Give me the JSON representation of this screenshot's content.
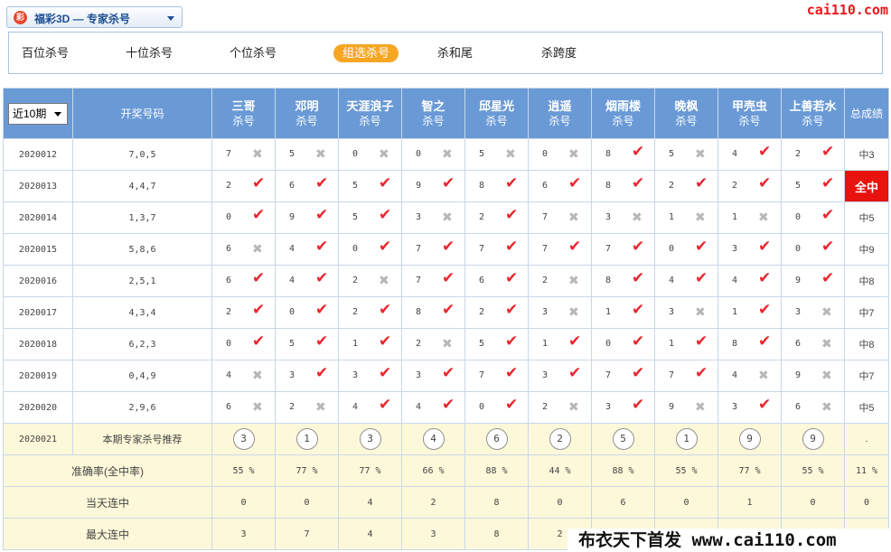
{
  "header": {
    "lottery_logo": "彩",
    "lottery_title": "福彩3D — 专家杀号",
    "brand": "cai110.com"
  },
  "tabs": [
    "百位杀号",
    "十位杀号",
    "个位杀号",
    "组选杀号",
    "杀和尾",
    "杀跨度"
  ],
  "active_tab": 3,
  "table": {
    "period_select": "近10期",
    "draw_col": "开奖号码",
    "total_col": "总成绩",
    "experts": [
      {
        "name": "三哥",
        "sub": "杀号"
      },
      {
        "name": "邓明",
        "sub": "杀号"
      },
      {
        "name": "天涯浪子",
        "sub": "杀号"
      },
      {
        "name": "智之",
        "sub": "杀号"
      },
      {
        "name": "邱星光",
        "sub": "杀号"
      },
      {
        "name": "逍遥",
        "sub": "杀号"
      },
      {
        "name": "烟雨楼",
        "sub": "杀号"
      },
      {
        "name": "晚枫",
        "sub": "杀号"
      },
      {
        "name": "甲壳虫",
        "sub": "杀号"
      },
      {
        "name": "上善若水",
        "sub": "杀号"
      }
    ],
    "rows": [
      {
        "period": "2020012",
        "draw": "7,0,5",
        "picks": [
          7,
          5,
          0,
          0,
          5,
          0,
          8,
          5,
          4,
          2
        ],
        "hits": [
          0,
          0,
          0,
          0,
          0,
          0,
          1,
          0,
          1,
          1
        ],
        "total": "中3"
      },
      {
        "period": "2020013",
        "draw": "4,4,7",
        "picks": [
          2,
          6,
          5,
          9,
          8,
          6,
          8,
          2,
          2,
          5
        ],
        "hits": [
          1,
          1,
          1,
          1,
          1,
          1,
          1,
          1,
          1,
          1
        ],
        "total": "全中",
        "full": true
      },
      {
        "period": "2020014",
        "draw": "1,3,7",
        "picks": [
          0,
          9,
          5,
          3,
          2,
          7,
          3,
          1,
          1,
          0
        ],
        "hits": [
          1,
          1,
          1,
          0,
          1,
          0,
          0,
          0,
          0,
          1
        ],
        "total": "中5"
      },
      {
        "period": "2020015",
        "draw": "5,8,6",
        "picks": [
          6,
          4,
          0,
          7,
          7,
          7,
          7,
          0,
          3,
          0
        ],
        "hits": [
          0,
          1,
          1,
          1,
          1,
          1,
          1,
          1,
          1,
          1
        ],
        "total": "中9"
      },
      {
        "period": "2020016",
        "draw": "2,5,1",
        "picks": [
          6,
          4,
          2,
          7,
          6,
          2,
          8,
          4,
          4,
          9
        ],
        "hits": [
          1,
          1,
          0,
          1,
          1,
          0,
          1,
          1,
          1,
          1
        ],
        "total": "中8"
      },
      {
        "period": "2020017",
        "draw": "4,3,4",
        "picks": [
          2,
          0,
          2,
          8,
          2,
          3,
          1,
          3,
          1,
          3
        ],
        "hits": [
          1,
          1,
          1,
          1,
          1,
          0,
          1,
          0,
          1,
          0
        ],
        "total": "中7"
      },
      {
        "period": "2020018",
        "draw": "6,2,3",
        "picks": [
          0,
          5,
          1,
          2,
          5,
          1,
          0,
          1,
          8,
          6
        ],
        "hits": [
          1,
          1,
          1,
          0,
          1,
          1,
          1,
          1,
          1,
          0
        ],
        "total": "中8"
      },
      {
        "period": "2020019",
        "draw": "0,4,9",
        "picks": [
          4,
          3,
          3,
          3,
          7,
          3,
          7,
          7,
          4,
          9
        ],
        "hits": [
          0,
          1,
          1,
          1,
          1,
          1,
          1,
          1,
          0,
          0
        ],
        "total": "中7"
      },
      {
        "period": "2020020",
        "draw": "2,9,6",
        "picks": [
          6,
          2,
          4,
          4,
          0,
          2,
          3,
          9,
          3,
          6
        ],
        "hits": [
          0,
          0,
          1,
          1,
          1,
          0,
          1,
          0,
          1,
          0
        ],
        "total": "中5"
      }
    ],
    "recommend": {
      "period": "2020021",
      "label": "本期专家杀号推荐",
      "picks": [
        3,
        1,
        3,
        4,
        6,
        2,
        5,
        1,
        9,
        9
      ],
      "total": "."
    },
    "accuracy": {
      "label": "准确率(全中率)",
      "values": [
        "55 %",
        "77 %",
        "77 %",
        "66 %",
        "88 %",
        "44 %",
        "88 %",
        "55 %",
        "77 %",
        "55 %"
      ],
      "total": "11 %"
    },
    "current_streak": {
      "label": "当天连中",
      "values": [
        "0",
        "0",
        "4",
        "2",
        "8",
        "0",
        "6",
        "0",
        "1",
        "0"
      ],
      "total": "0"
    },
    "max_streak": {
      "label": "最大连中",
      "values": [
        "3",
        "7",
        "4",
        "3",
        "8",
        "2",
        "",
        "",
        "",
        ""
      ],
      "total": ""
    }
  },
  "watermark": "布衣天下首发 www.cai110.com"
}
